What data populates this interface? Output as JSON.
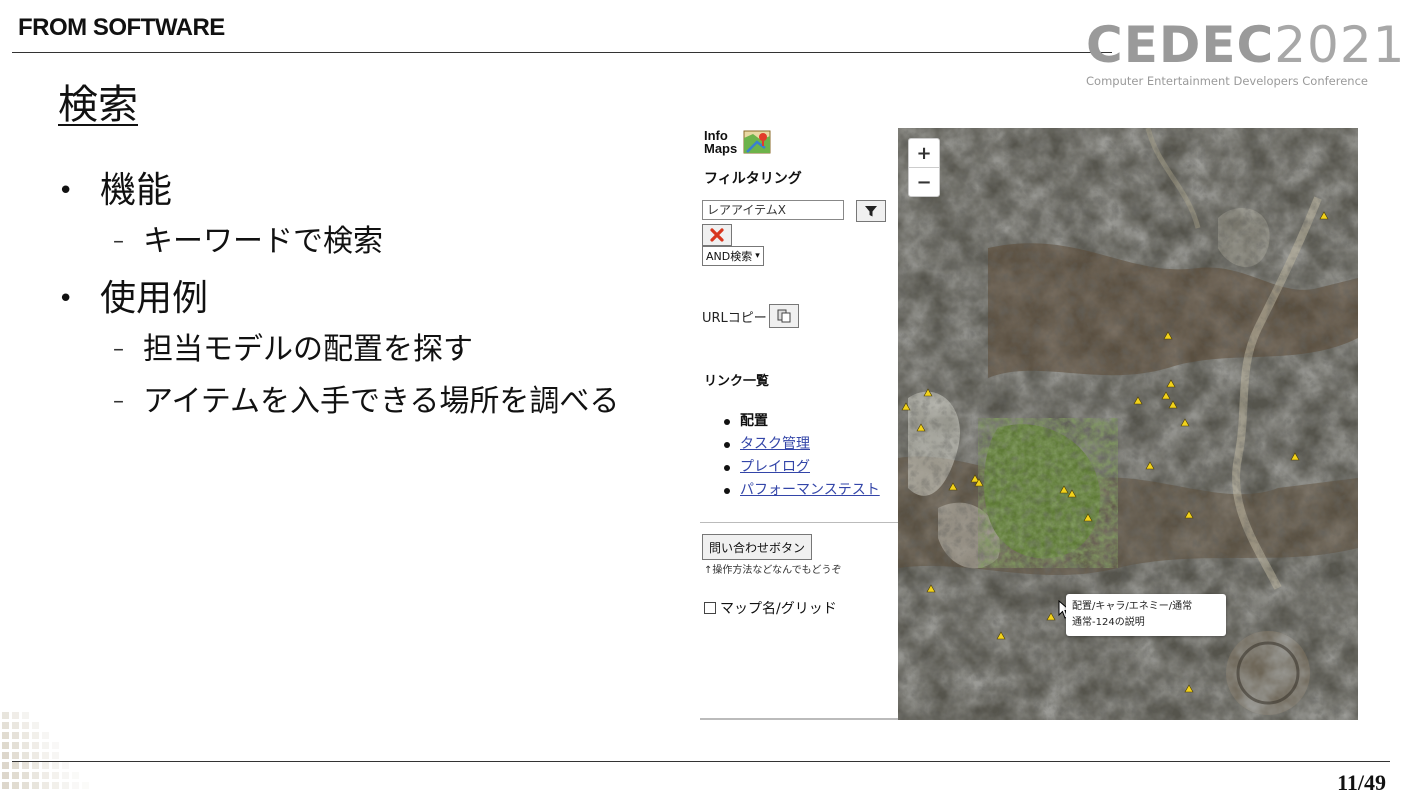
{
  "header": {
    "brand": "FROM SOFTWARE",
    "cedec_logo_bold": "CEDEC",
    "cedec_logo_year": "2021",
    "cedec_subtitle": "Computer Entertainment Developers Conference"
  },
  "slide": {
    "title": "検索",
    "bullets": [
      {
        "text": "機能",
        "sub": [
          "キーワードで検索"
        ]
      },
      {
        "text": "使用例",
        "sub": [
          "担当モデルの配置を探す",
          "アイテムを入手できる場所を調べる"
        ]
      }
    ],
    "page": "11/49"
  },
  "app": {
    "logo_line1": "Info",
    "logo_line2": "Maps",
    "filter_title": "フィルタリング",
    "search_value": "レアアイテムX",
    "and_select": "AND検索",
    "url_copy_label": "URLコピー",
    "links_title": "リンク一覧",
    "links": [
      {
        "label": "配置",
        "linked": false
      },
      {
        "label": "タスク管理",
        "linked": true
      },
      {
        "label": "プレイログ",
        "linked": true
      },
      {
        "label": "パフォーマンステスト",
        "linked": true
      }
    ],
    "inquiry_button": "問い合わせボタン",
    "inquiry_note": "↑操作方法などなんでもどうぞ",
    "grid_checkbox_label": "マップ名/グリッド",
    "map": {
      "zoom_in": "+",
      "zoom_out": "−",
      "tooltip_line1": "配置/キャラ/エネミー/通常",
      "tooltip_line2": "通常-124の説明",
      "marker_color": "#f2d21b"
    }
  }
}
